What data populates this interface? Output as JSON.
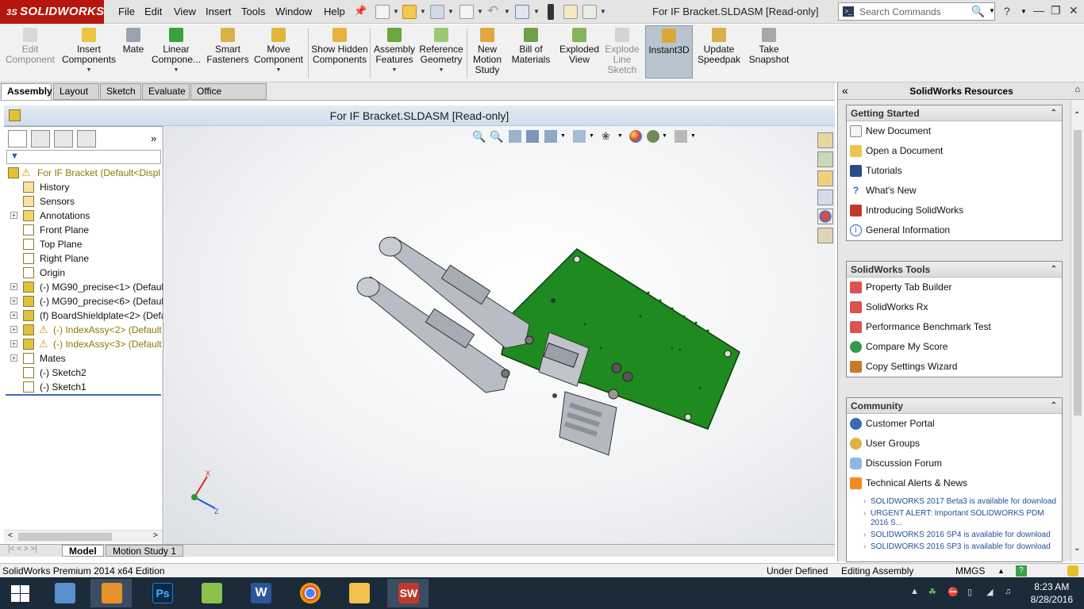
{
  "titlebar": {
    "logo": "SOLIDWORKS",
    "logo_prefix": "3S",
    "menu": [
      "File",
      "Edit",
      "View",
      "Insert",
      "Tools",
      "Window",
      "Help"
    ],
    "document_title": "For IF Bracket.SLDASM [Read-only]",
    "search_placeholder": "Search Commands",
    "help_label": "?"
  },
  "ribbon": {
    "edit_component": "Edit Component",
    "insert_components": "Insert Components",
    "mate": "Mate",
    "linear_component": "Linear Compone...",
    "smart_fasteners": "Smart Fasteners",
    "move_component": "Move Component",
    "show_hidden": "Show Hidden Components",
    "assembly_features": "Assembly Features",
    "reference_geometry": "Reference Geometry",
    "new_motion_study": "New Motion Study",
    "bill_of_materials": "Bill of Materials",
    "exploded_view": "Exploded View",
    "explode_line_sketch": "Explode Line Sketch",
    "instant3d": "Instant3D",
    "update_speedpak": "Update Speedpak",
    "take_snapshot": "Take Snapshot"
  },
  "command_tabs": [
    "Assembly",
    "Layout",
    "Sketch",
    "Evaluate",
    "Office Products"
  ],
  "viewport": {
    "title": "For IF Bracket.SLDASM [Read-only]",
    "triad": {
      "x": "X",
      "z": "Z"
    }
  },
  "feature_tree": {
    "root": "For IF Bracket  (Default<Displ",
    "items": [
      {
        "label": "History",
        "expand": false,
        "warn": false
      },
      {
        "label": "Sensors",
        "expand": false,
        "warn": false
      },
      {
        "label": "Annotations",
        "expand": true,
        "warn": false
      },
      {
        "label": "Front Plane",
        "expand": false,
        "warn": false
      },
      {
        "label": "Top Plane",
        "expand": false,
        "warn": false
      },
      {
        "label": "Right Plane",
        "expand": false,
        "warn": false
      },
      {
        "label": "Origin",
        "expand": false,
        "warn": false
      },
      {
        "label": "(-) MG90_precise<1> (Defaul",
        "expand": true,
        "warn": false
      },
      {
        "label": "(-) MG90_precise<6> (Defaul",
        "expand": true,
        "warn": false
      },
      {
        "label": "(f) BoardShieldplate<2> (Defa",
        "expand": true,
        "warn": false
      },
      {
        "label": "(-) IndexAssy<2> (Default",
        "expand": true,
        "warn": true
      },
      {
        "label": "(-) IndexAssy<3> (Default",
        "expand": true,
        "warn": true
      },
      {
        "label": "Mates",
        "expand": true,
        "warn": false
      },
      {
        "label": "(-) Sketch2",
        "expand": false,
        "warn": false
      },
      {
        "label": "(-) Sketch1",
        "expand": false,
        "warn": false
      }
    ]
  },
  "bottom_tabs": [
    "Model",
    "Motion Study 1"
  ],
  "task_pane": {
    "title": "SolidWorks Resources",
    "getting_started": {
      "title": "Getting Started",
      "items": [
        "New Document",
        "Open a Document",
        "Tutorials",
        "What's New",
        "Introducing SolidWorks",
        "General Information"
      ]
    },
    "tools": {
      "title": "SolidWorks Tools",
      "items": [
        "Property Tab Builder",
        "SolidWorks Rx",
        "Performance Benchmark Test",
        "Compare My Score",
        "Copy Settings Wizard"
      ]
    },
    "community": {
      "title": "Community",
      "items": [
        "Customer Portal",
        "User Groups",
        "Discussion Forum",
        "Technical Alerts & News"
      ],
      "news": [
        "SOLIDWORKS 2017 Beta3 is available for download",
        "URGENT ALERT: Important SOLIDWORKS PDM 2016 S...",
        "SOLIDWORKS 2016 SP4 is available for download",
        "SOLIDWORKS 2016 SP3 is available for download"
      ]
    }
  },
  "status_bar": {
    "edition": "SolidWorks Premium 2014 x64 Edition",
    "definition": "Under Defined",
    "mode": "Editing Assembly",
    "units": "MMGS"
  },
  "taskbar": {
    "time": "8:23 AM",
    "date": "8/28/2016"
  },
  "colors": {
    "brand_red": "#b5170f",
    "board_green": "#1f8a1f",
    "warning_yellow": "#d4b800"
  }
}
